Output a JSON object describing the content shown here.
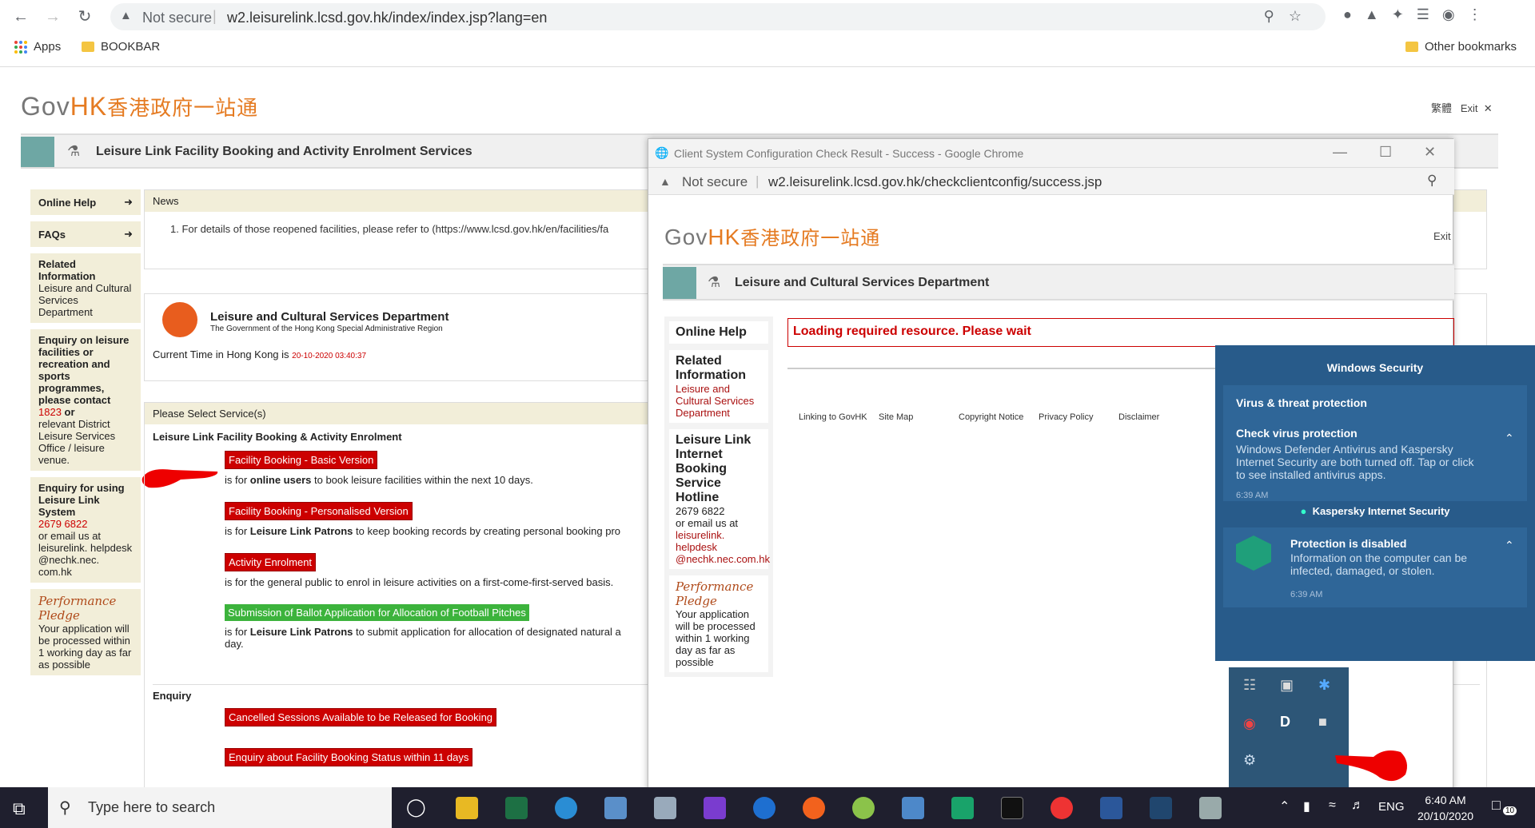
{
  "browser": {
    "security_label": "Not secure",
    "url": "w2.leisurelink.lcsd.gov.hk/index/index.jsp?lang=en",
    "bookmarks": [
      {
        "label": "Apps"
      },
      {
        "label": "BOOKBAR"
      }
    ],
    "other_bookmarks": "Other bookmarks"
  },
  "page": {
    "logo_en_gov": "Gov",
    "logo_en_hk": "HK",
    "logo_cn": "香港政府一站通",
    "lang_link": "繁體",
    "exit_link": "Exit",
    "service_title": "Leisure Link Facility Booking and Activity Enrolment Services",
    "sidebar": {
      "online_help": "Online Help",
      "faqs": "FAQs",
      "related_title": "Related Information",
      "related_link": "Leisure and Cultural Services Department",
      "enquiry_title": "Enquiry on leisure facilities or recreation and sports programmes, please contact",
      "enquiry_phone": "1823",
      "enquiry_or": "or",
      "enquiry_rest": "relevant District Leisure Services Office / leisure venue.",
      "using_title": "Enquiry for using Leisure Link System",
      "using_phone": "2679 6822",
      "using_email_pre": "or email us at",
      "using_email": "leisurelink. helpdesk @nechk.nec. com.hk",
      "pledge_logo": "Performance Pledge",
      "pledge_text": "Your application will be processed within 1 working day as far as possible"
    },
    "news": {
      "label": "News",
      "item": "1.  For details of those reopened facilities, please refer to (https://www.lcsd.gov.hk/en/facilities/fa"
    },
    "dept": {
      "name": "Leisure and Cultural Services Department",
      "sub": "The Government of the Hong Kong Special Administrative Region",
      "time_label": "Current Time in Hong Kong is",
      "time_value": "20-10-2020 03:40:37"
    },
    "services": {
      "title": "Please Select Service(s)",
      "subtitle": "Leisure Link Facility Booking & Activity Enrolment",
      "items": [
        {
          "button": "Facility Booking - Basic Version",
          "pre": "is for",
          "bold": "online users",
          "post": "to book leisure facilities within the next 10 days."
        },
        {
          "button": "Facility Booking - Personalised Version",
          "pre": "is for",
          "bold": "Leisure Link Patrons",
          "post": "to keep booking records by creating personal booking pro"
        },
        {
          "button": "Activity Enrolment",
          "pre": "is for the general public to enrol in leisure activities on a first-come-first-served basis.",
          "bold": "",
          "post": ""
        },
        {
          "button": "Submission of Ballot Application for Allocation of Football Pitches",
          "pre": "is for",
          "bold": "Leisure Link Patrons",
          "post": "to submit application for allocation of designated natural a"
        }
      ],
      "item4_tail": "day.",
      "enquiry_title": "Enquiry",
      "enquiry_buttons": [
        "Cancelled Sessions Available to be Released for Booking",
        "Enquiry about Facility Booking Status within 11 days"
      ]
    }
  },
  "popup": {
    "title": "Client System Configuration Check Result - Success - Google Chrome",
    "security_label": "Not secure",
    "url": "w2.leisurelink.lcsd.gov.hk/checkclientconfig/success.jsp",
    "exit": "Exit",
    "header": "Leisure and Cultural Services Department",
    "online_help": "Online Help",
    "related_title": "Related Information",
    "related_link": "Leisure and Cultural Services Department",
    "hotline_title": "Leisure Link Internet Booking Service Hotline",
    "hotline_phone": "2679 6822",
    "hotline_email_pre": "or email us at",
    "hotline_email": "leisurelink. helpdesk @nechk.nec.com.hk",
    "pledge_logo": "Performance Pledge",
    "pledge_text": "Your application will be processed within 1 working day as far as possible",
    "loading": "Loading required resource. Please wait",
    "footer_links": [
      "Linking to GovHK",
      "Site Map",
      "Copyright Notice",
      "Privacy Policy",
      "Disclaimer"
    ]
  },
  "windows_security": {
    "header": "Windows Security",
    "section": "Virus & threat protection",
    "n1_title": "Check virus protection",
    "n1_body": "Windows Defender Antivirus and Kaspersky Internet Security are both turned off. Tap or click to see installed antivirus apps.",
    "n1_time": "6:39 AM",
    "kaspersky": "Kaspersky Internet Security",
    "n2_title": "Protection is disabled",
    "n2_body": "Information on the computer can be infected, damaged, or stolen.",
    "n2_time": "6:39 AM"
  },
  "taskbar": {
    "search_placeholder": "Type here to search",
    "lang": "ENG",
    "time": "6:40 AM",
    "date": "20/10/2020",
    "notif_count": "10"
  }
}
